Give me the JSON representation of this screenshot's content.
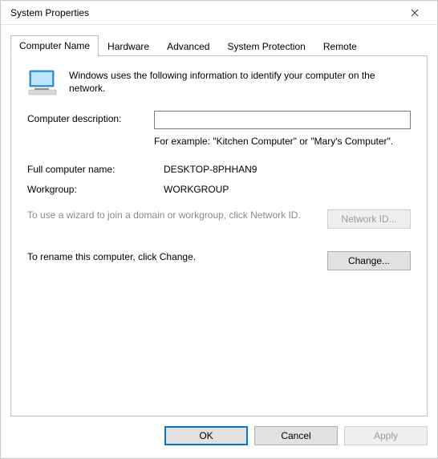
{
  "window": {
    "title": "System Properties"
  },
  "tabs": {
    "computer_name": "Computer Name",
    "hardware": "Hardware",
    "advanced": "Advanced",
    "system_protection": "System Protection",
    "remote": "Remote"
  },
  "intro_text": "Windows uses the following information to identify your computer on the network.",
  "fields": {
    "description_label": "Computer description:",
    "description_value": "",
    "example_text": "For example: \"Kitchen Computer\" or \"Mary's Computer\".",
    "fullname_label": "Full computer name:",
    "fullname_value": "DESKTOP-8PHHAN9",
    "workgroup_label": "Workgroup:",
    "workgroup_value": "WORKGROUP"
  },
  "helpers": {
    "network_id_text": "To use a wizard to join a domain or workgroup, click Network ID.",
    "network_id_button": "Network ID...",
    "change_text": "To rename this computer, click Change.",
    "change_button": "Change..."
  },
  "buttons": {
    "ok": "OK",
    "cancel": "Cancel",
    "apply": "Apply"
  }
}
